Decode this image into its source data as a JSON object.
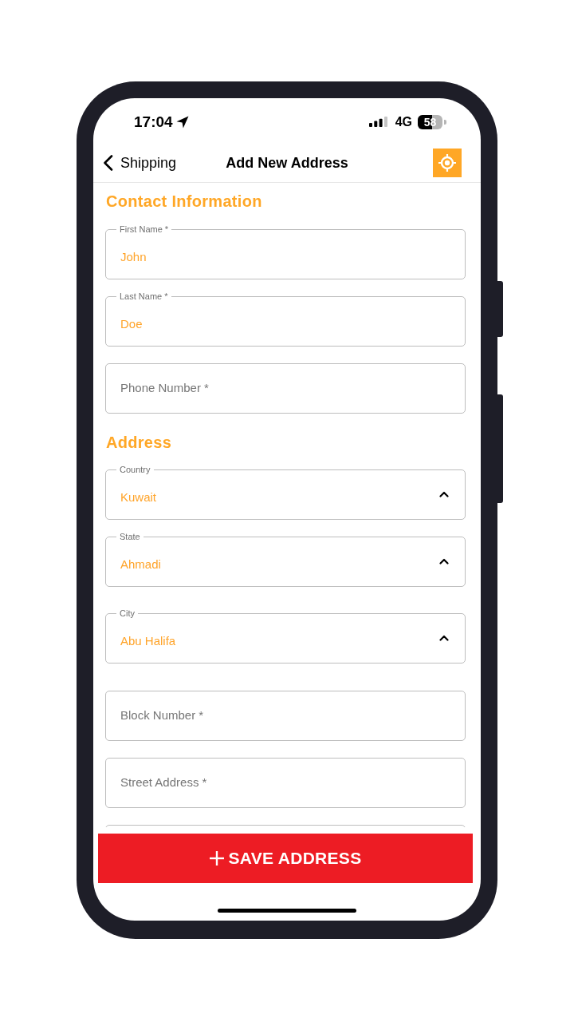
{
  "status_bar": {
    "time": "17:04",
    "network": "4G",
    "battery": "58"
  },
  "nav_bar": {
    "back_label": "Shipping",
    "title": "Add New Address"
  },
  "sections": [
    {
      "heading": "Contact Information",
      "fields": [
        {
          "kind": "text",
          "label": "First Name *",
          "value": "John"
        },
        {
          "kind": "text",
          "label": "Last Name *",
          "value": "Doe"
        },
        {
          "kind": "text",
          "placeholder": "Phone Number *"
        }
      ]
    },
    {
      "heading": "Address",
      "fields": [
        {
          "kind": "select",
          "label": "Country",
          "value": "Kuwait"
        },
        {
          "kind": "select",
          "label": "State",
          "value": "Ahmadi"
        },
        {
          "kind": "select",
          "label": "City",
          "value": "Abu Halifa"
        },
        {
          "kind": "text",
          "placeholder": "Block Number *"
        },
        {
          "kind": "text",
          "placeholder": "Street Address *"
        },
        {
          "kind": "text"
        }
      ]
    }
  ],
  "save_button": {
    "label": "SAVE ADDRESS"
  }
}
